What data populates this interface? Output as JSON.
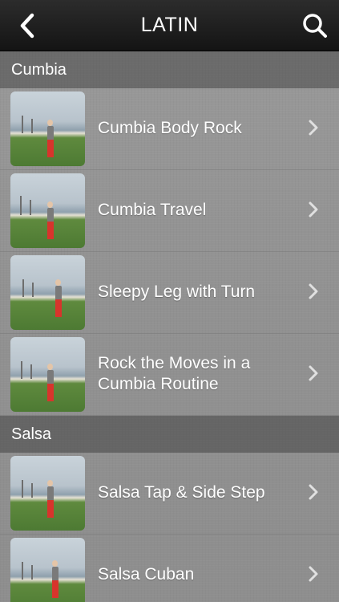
{
  "navbar": {
    "title": "LATIN",
    "back_icon": "chevron-left-icon",
    "search_icon": "search-icon"
  },
  "sections": [
    {
      "header": "Cumbia",
      "items": [
        {
          "title": "Cumbia Body Rock"
        },
        {
          "title": "Cumbia Travel"
        },
        {
          "title": "Sleepy Leg with Turn"
        },
        {
          "title": "Rock the Moves in a Cumbia Routine"
        }
      ]
    },
    {
      "header": "Salsa",
      "items": [
        {
          "title": "Salsa Tap & Side Step"
        },
        {
          "title": "Salsa Cuban"
        }
      ]
    }
  ],
  "colors": {
    "navbar": "#1a1a1a",
    "text": "#ffffff",
    "chevron": "#e0e0e0"
  }
}
